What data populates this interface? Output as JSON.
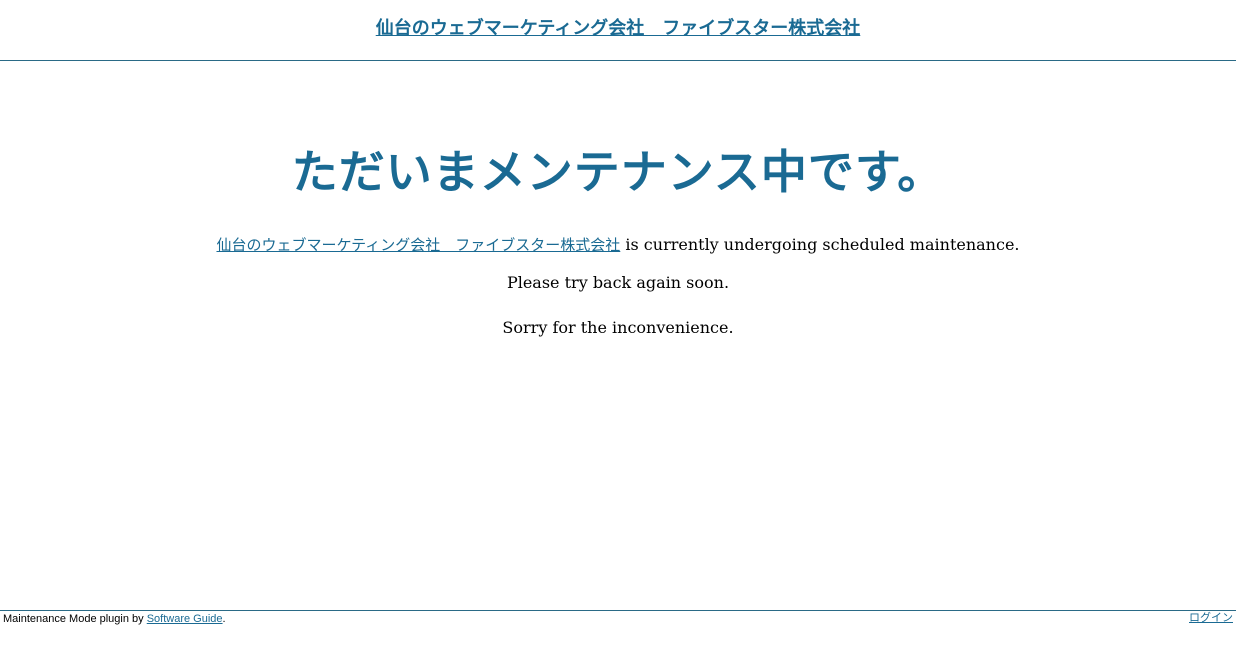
{
  "header": {
    "site_title": "仙台のウェブマーケティング会社　ファイブスター株式会社"
  },
  "main": {
    "heading": "ただいまメンテナンス中です。",
    "company_link": "仙台のウェブマーケティング会社　ファイブスター株式会社",
    "maintenance_text": " is currently undergoing scheduled maintenance.",
    "try_back_text": "Please try back again soon.",
    "sorry_text": "Sorry for the inconvenience."
  },
  "footer": {
    "credit_prefix": "Maintenance Mode plugin by ",
    "credit_link": "Software Guide",
    "credit_suffix": ".",
    "login_link": "ログイン"
  },
  "colors": {
    "accent": "#1a6a93",
    "divider": "#2a6a86",
    "background": "#ffffff",
    "text": "#000000"
  }
}
